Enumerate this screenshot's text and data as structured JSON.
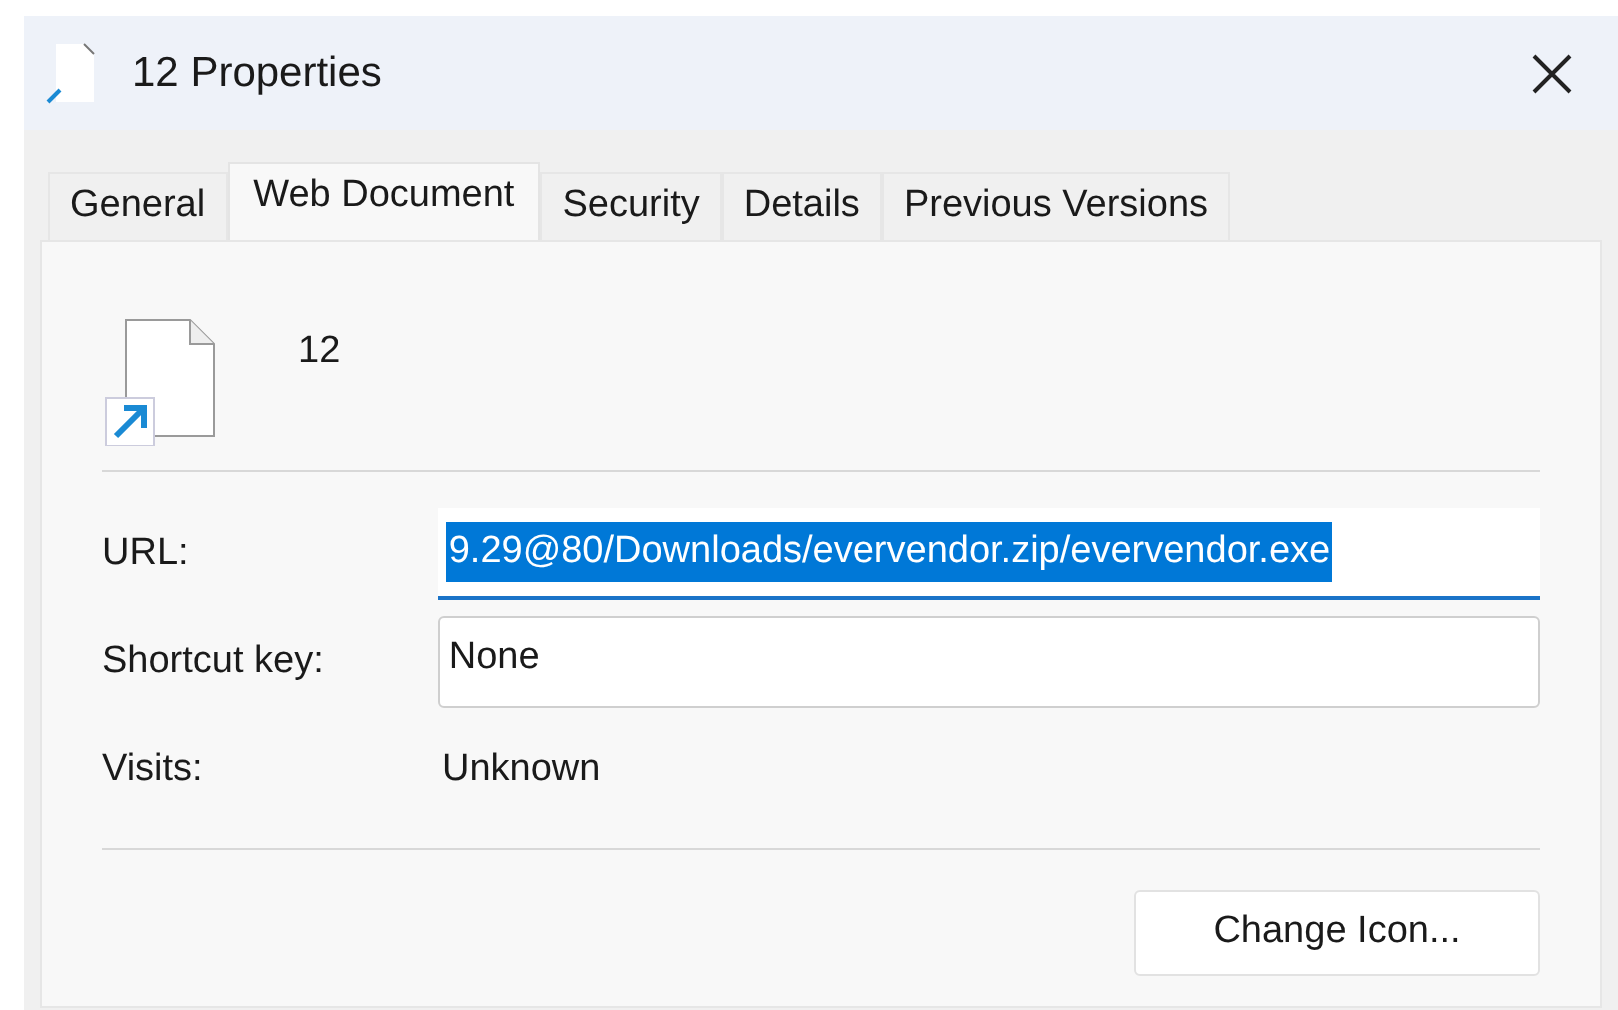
{
  "window": {
    "title": "12 Properties"
  },
  "tabs": [
    {
      "label": "General",
      "selected": false
    },
    {
      "label": "Web Document",
      "selected": true
    },
    {
      "label": "Security",
      "selected": false
    },
    {
      "label": "Details",
      "selected": false
    },
    {
      "label": "Previous Versions",
      "selected": false
    }
  ],
  "file": {
    "name": "12"
  },
  "fields": [
    {
      "kind": "input",
      "label": "URL:",
      "value": "9.29@80/Downloads/evervendor.zip/evervendor.exe",
      "selected": true
    },
    {
      "kind": "input",
      "label": "Shortcut key:",
      "value": "None",
      "selected": false
    },
    {
      "kind": "text",
      "label": "Visits:",
      "value": "Unknown"
    }
  ],
  "buttons": [
    "Change Icon..."
  ]
}
